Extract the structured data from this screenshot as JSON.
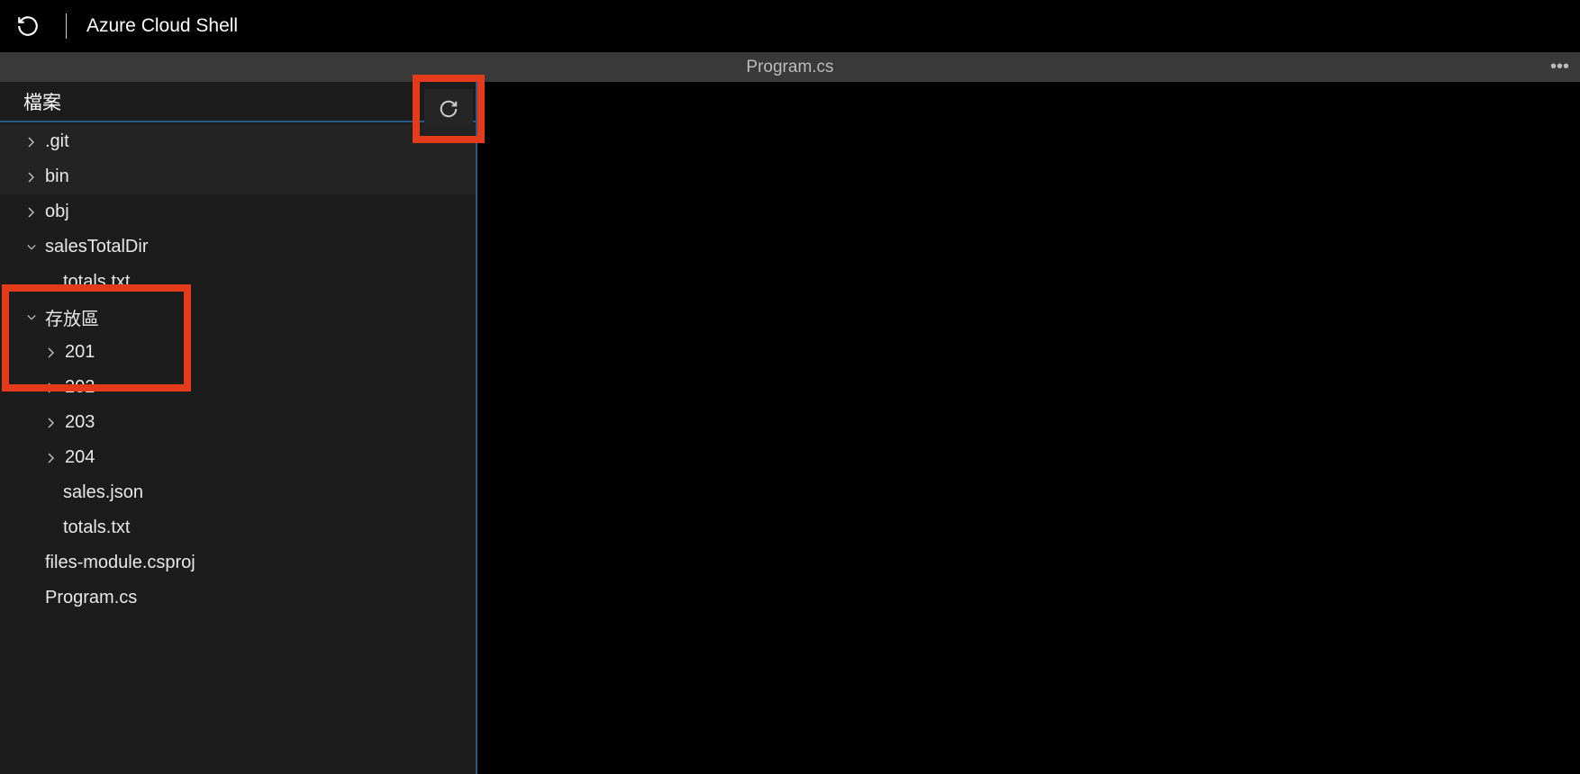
{
  "header": {
    "title": "Azure Cloud Shell"
  },
  "tab": {
    "filename": "Program.cs",
    "ellipsis": "•••"
  },
  "sidebar": {
    "title": "檔案",
    "tree": {
      "git": ".git",
      "bin": "bin",
      "obj": "obj",
      "salesTotalDir": "salesTotalDir",
      "salesTotalDir_file": "totals.txt",
      "stores": "存放區",
      "store201": "201",
      "store202": "202",
      "store203": "203",
      "store204": "204",
      "salesJson": "sales.json",
      "totalsTxt": "totals.txt",
      "csproj": "files-module.csproj",
      "programcs": "Program.cs"
    }
  }
}
